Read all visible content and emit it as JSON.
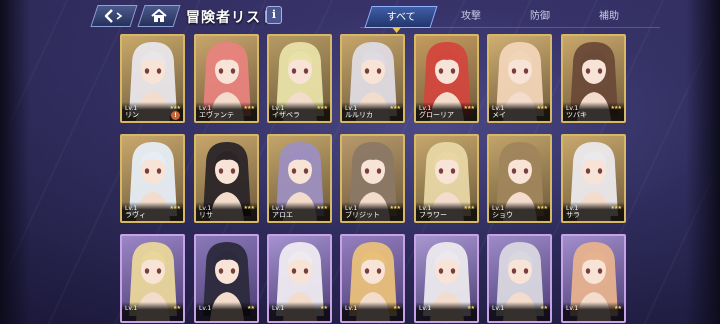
{
  "header": {
    "title": "冒険者リスト",
    "info_label": "i"
  },
  "tabs": [
    {
      "label": "すべて",
      "active": true
    },
    {
      "label": "攻撃",
      "active": false
    },
    {
      "label": "防御",
      "active": false
    },
    {
      "label": "補助",
      "active": false
    }
  ],
  "colors": {
    "gold_frame": "#d7b865",
    "purple_frame": "#c7a2e6",
    "star": "#f6d25a"
  },
  "cards": [
    {
      "level": "Lv.1",
      "name": "リン",
      "stars": "★★★",
      "alert": "!",
      "frame": "gold",
      "hair": "#e9e6ea",
      "bg": "#c9a96a"
    },
    {
      "level": "Lv.1",
      "name": "エヴァンテ",
      "stars": "★★★",
      "frame": "gold",
      "hair": "#e7837d",
      "bg": "#c8a56b"
    },
    {
      "level": "Lv.1",
      "name": "イザベラ",
      "stars": "★★★",
      "frame": "gold",
      "hair": "#e8e2a8",
      "bg": "#b59a63"
    },
    {
      "level": "Lv.1",
      "name": "ルルリカ",
      "stars": "★★★",
      "frame": "gold",
      "hair": "#dfdbe2",
      "bg": "#c6a56a"
    },
    {
      "level": "Lv.1",
      "name": "グローリア",
      "stars": "★★★",
      "frame": "gold",
      "hair": "#d2473d",
      "bg": "#c59b5e"
    },
    {
      "level": "Lv.1",
      "name": "メイ",
      "stars": "★★★",
      "frame": "gold",
      "hair": "#f1d5b7",
      "bg": "#d0ae72"
    },
    {
      "level": "Lv.1",
      "name": "ツバキ",
      "stars": "★★★",
      "frame": "gold",
      "hair": "#6a4a38",
      "bg": "#c9a76a"
    },
    {
      "level": "Lv.1",
      "name": "ラヴィ",
      "stars": "★★★",
      "frame": "gold",
      "hair": "#e6edf4",
      "bg": "#c9a86c"
    },
    {
      "level": "Lv.1",
      "name": "リサ",
      "stars": "★★★",
      "frame": "gold",
      "hair": "#2b2528",
      "bg": "#c8a66a"
    },
    {
      "level": "Lv.1",
      "name": "アロエ",
      "stars": "★★★",
      "frame": "gold",
      "hair": "#9c8fbf",
      "bg": "#c3a56a"
    },
    {
      "level": "Lv.1",
      "name": "ブリジット",
      "stars": "★★★",
      "frame": "gold",
      "hair": "#8b7865",
      "bg": "#b8996a"
    },
    {
      "level": "Lv.1",
      "name": "フラワー",
      "stars": "★★★",
      "frame": "gold",
      "hair": "#e8d7a5",
      "bg": "#c6a66b"
    },
    {
      "level": "Lv.1",
      "name": "ショウ",
      "stars": "★★★",
      "frame": "gold",
      "hair": "#a0855c",
      "bg": "#c2a46a"
    },
    {
      "level": "Lv.1",
      "name": "サラ",
      "stars": "★★★",
      "frame": "gold",
      "hair": "#ece9ec",
      "bg": "#c8a86c"
    },
    {
      "level": "Lv.1",
      "name": "",
      "stars": "★★",
      "frame": "purple",
      "hair": "#e9d69a",
      "bg": "#9b86c6"
    },
    {
      "level": "Lv.1",
      "name": "",
      "stars": "★★",
      "frame": "purple",
      "hair": "#2c2a3c",
      "bg": "#8a78b8"
    },
    {
      "level": "Lv.1",
      "name": "",
      "stars": "★★",
      "frame": "purple",
      "hair": "#eeeaf0",
      "bg": "#a592cf"
    },
    {
      "level": "Lv.1",
      "name": "",
      "stars": "★★",
      "frame": "purple",
      "hair": "#e9c07a",
      "bg": "#957fc0"
    },
    {
      "level": "Lv.1",
      "name": "",
      "stars": "★★",
      "frame": "purple",
      "hair": "#ece9ee",
      "bg": "#a896d0"
    },
    {
      "level": "Lv.1",
      "name": "",
      "stars": "★★",
      "frame": "purple",
      "hair": "#d9d7e0",
      "bg": "#9d8bc8"
    },
    {
      "level": "Lv.1",
      "name": "",
      "stars": "★★",
      "frame": "purple",
      "hair": "#e7b28e",
      "bg": "#a18ecb"
    }
  ]
}
